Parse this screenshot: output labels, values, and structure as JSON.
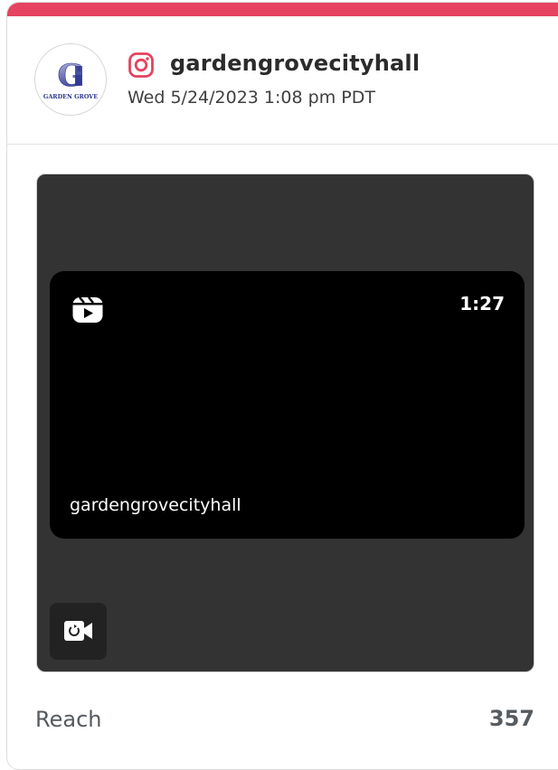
{
  "post": {
    "account_name": "gardengrovecityhall",
    "timestamp": "Wed 5/24/2023 1:08 pm PDT",
    "platform_icon": "instagram-icon",
    "avatar_icon": "garden-grove-logo",
    "avatar_text": "GARDEN GROVE",
    "accent_color": "#e5435f"
  },
  "media": {
    "type_icon": "reels-icon",
    "duration": "1:27",
    "caption": "gardengrovecityhall",
    "badge_icon": "video-camera-icon"
  },
  "metrics": [
    {
      "label": "Reach",
      "value": "357"
    }
  ]
}
